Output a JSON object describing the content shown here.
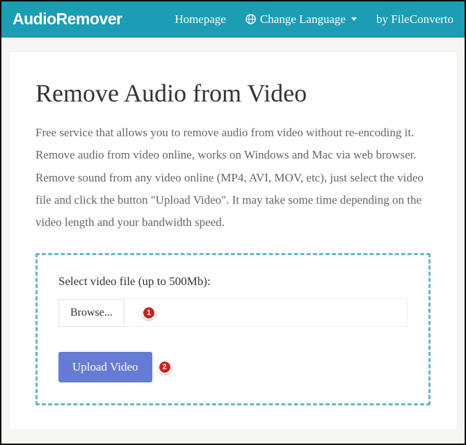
{
  "navbar": {
    "brand": "AudioRemover",
    "homepage": "Homepage",
    "change_language": "Change Language",
    "by_converto": "by FileConverto"
  },
  "heading": "Remove Audio from Video",
  "description": "Free service that allows you to remove audio from video without re-encoding it. Remove audio from video online, works on Windows and Mac via web browser. Remove sound from any video online (MP4, AVI, MOV, etc), just select the video file and click the button \"Upload Video\". It may take some time depending on the video length and your bandwidth speed.",
  "upload": {
    "label": "Select video file (up to 500Mb):",
    "browse": "Browse...",
    "submit": "Upload Video"
  },
  "annotations": {
    "step1": "1",
    "step2": "2"
  }
}
